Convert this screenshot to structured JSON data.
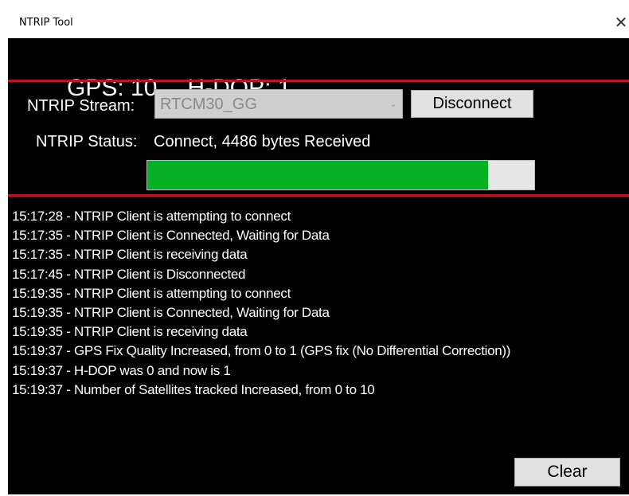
{
  "window": {
    "title": "NTRIP Tool",
    "close_glyph": "✕"
  },
  "header": {
    "gps": "GPS: 10",
    "hdop": "H-DOP: 1"
  },
  "stream": {
    "label": "NTRIP Stream:",
    "selected": "RTCM30_GG",
    "disconnect_label": "Disconnect"
  },
  "status": {
    "label": "NTRIP Status:",
    "value": "Connect, 4486 bytes Received",
    "progress": 0.88
  },
  "log": [
    "15:17:28 - NTRIP Client is attempting to connect",
    "15:17:35 - NTRIP Client is Connected, Waiting for Data",
    "15:17:35 - NTRIP Client is receiving data",
    "15:17:45 - NTRIP Client is Disconnected",
    "15:19:35 - NTRIP Client is attempting to connect",
    "15:19:35 - NTRIP Client is Connected, Waiting for Data",
    "15:19:35 - NTRIP Client is receiving data",
    "15:19:37 - GPS Fix Quality Increased, from 0 to 1 (GPS fix (No Differential Correction))",
    "15:19:37 - H-DOP was 0 and now is 1",
    "15:19:37 - Number of Satellites tracked Increased, from 0 to 10"
  ],
  "clear_label": "Clear",
  "colors": {
    "background": "#000000",
    "divider": "#c0141c",
    "progress_fill": "#06b025",
    "text": "#ffffff"
  }
}
